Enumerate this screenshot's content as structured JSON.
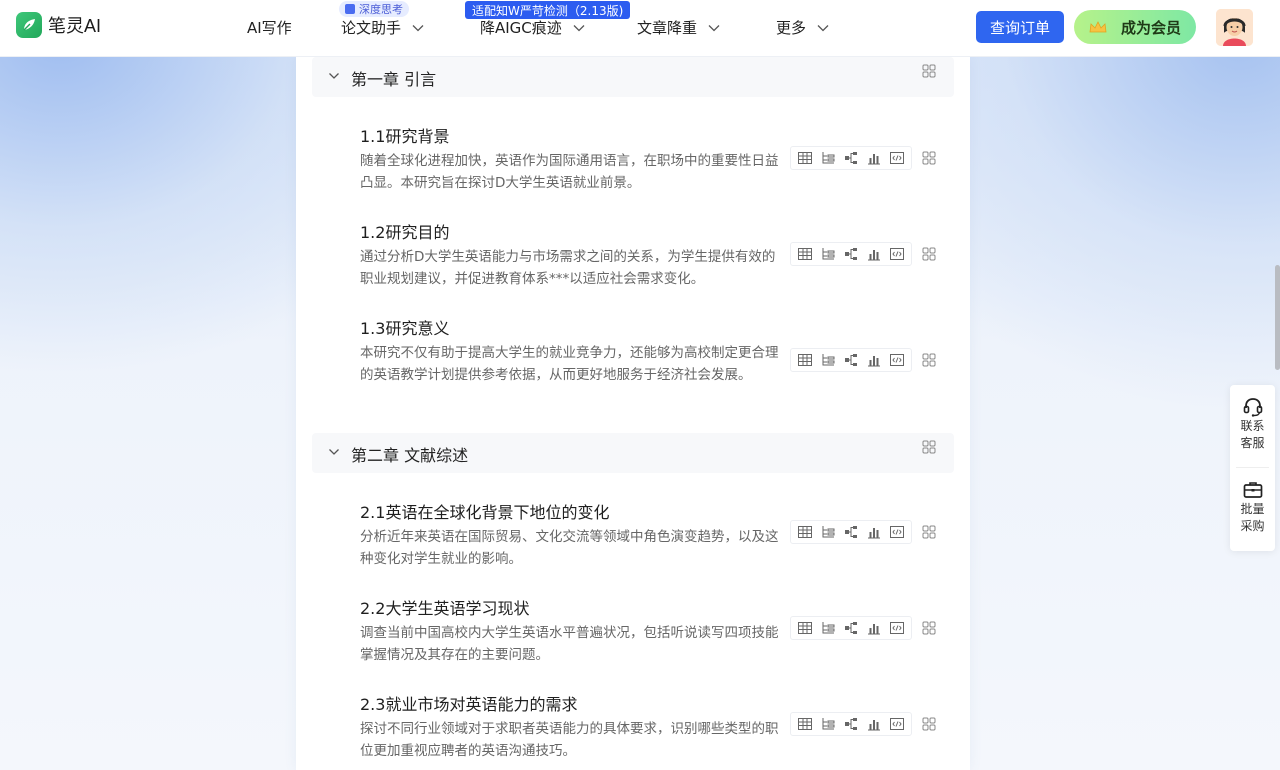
{
  "brand": {
    "name": "笔灵AI"
  },
  "nav": {
    "items": [
      {
        "label": "AI写作"
      },
      {
        "label": "论文助手"
      },
      {
        "label": "降AIGC痕迹"
      },
      {
        "label": "文章降重"
      },
      {
        "label": "更多"
      }
    ],
    "tag_soft": "深度思考",
    "tag_blue": "适配知W严苛检测（2.13版)"
  },
  "header": {
    "order_button": "查询订单",
    "vip_button": "成为会员"
  },
  "outline": {
    "chapters": [
      {
        "title": "第一章 引言",
        "sections": [
          {
            "title": "1.1研究背景",
            "desc": "随着全球化进程加快，英语作为国际通用语言，在职场中的重要性日益凸显。本研究旨在探讨D大学生英语就业前景。"
          },
          {
            "title": "1.2研究目的",
            "desc": "通过分析D大学生英语能力与市场需求之间的关系，为学生提供有效的职业规划建议，并促进教育体系***以适应社会需求变化。"
          },
          {
            "title": "1.3研究意义",
            "desc": "本研究不仅有助于提高大学生的就业竞争力，还能够为高校制定更合理的英语教学计划提供参考依据，从而更好地服务于经济社会发展。"
          }
        ]
      },
      {
        "title": "第二章 文献综述",
        "sections": [
          {
            "title": "2.1英语在全球化背景下地位的变化",
            "desc": "分析近年来英语在国际贸易、文化交流等领域中角色演变趋势，以及这种变化对学生就业的影响。"
          },
          {
            "title": "2.2大学生英语学习现状",
            "desc": "调查当前中国高校内大学生英语水平普遍状况，包括听说读写四项技能掌握情况及其存在的主要问题。"
          },
          {
            "title": "2.3就业市场对英语能力的需求",
            "desc": "探讨不同行业领域对于求职者英语能力的具体要求，识别哪些类型的职位更加重视应聘者的英语沟通技巧。"
          }
        ]
      }
    ],
    "section_tools": [
      "table-icon",
      "list-icon",
      "flow-icon",
      "bar-chart-icon",
      "code-icon"
    ]
  },
  "float_panel": {
    "contact": {
      "line1": "联系",
      "line2": "客服"
    },
    "bulk": {
      "line1": "批量",
      "line2": "采购"
    }
  },
  "colors": {
    "primary": "#2f66f0",
    "vip_gradient_start": "#b6f28a",
    "vip_gradient_end": "#7ee8a4",
    "brand_green": "#22a85a"
  }
}
